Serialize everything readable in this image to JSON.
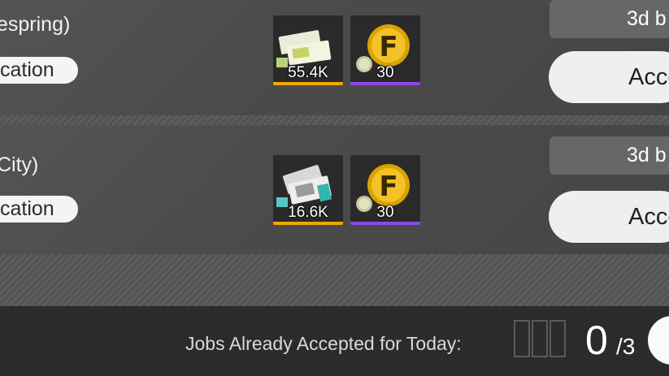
{
  "jobs": [
    {
      "title": "espring)",
      "location_label": "cation",
      "rewards": [
        {
          "icon": "tickets-icon",
          "quantity": "55.4K",
          "bar_color": "#f2a600"
        },
        {
          "icon": "gold-coin-icon",
          "quantity": "30",
          "bar_color": "#8b49e6"
        }
      ],
      "time_label": "3d b",
      "accept_label": "Acce"
    },
    {
      "title": "City)",
      "location_label": "cation",
      "rewards": [
        {
          "icon": "tickets-teal-icon",
          "quantity": "16.6K",
          "bar_color": "#f2a600"
        },
        {
          "icon": "gold-coin-icon",
          "quantity": "30",
          "bar_color": "#8b49e6"
        }
      ],
      "time_label": "3d b",
      "accept_label": "Acce"
    }
  ],
  "footer": {
    "label": "Jobs Already Accepted for Today:",
    "accepted_count": "0",
    "total": "/3"
  },
  "colors": {
    "row_bg": "#4b4b4b",
    "footer_bg": "#2b2b2b",
    "button_bg": "#efefef"
  }
}
